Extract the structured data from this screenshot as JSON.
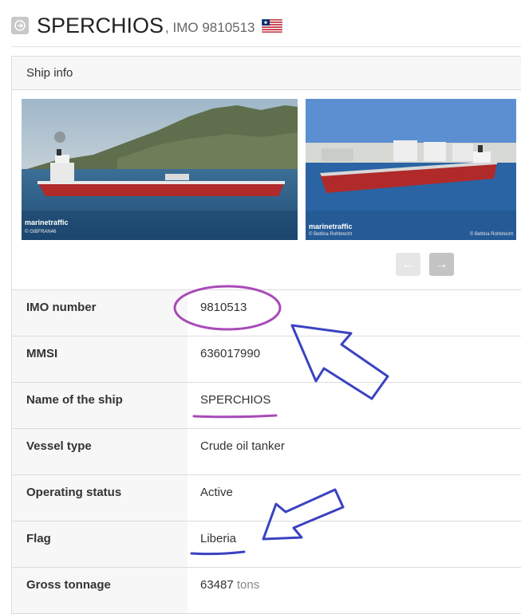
{
  "header": {
    "ship_name": "SPERCHIOS",
    "subtitle": ", IMO 9810513",
    "flag_icon": "liberia-flag-icon"
  },
  "panel": {
    "title": "Ship info"
  },
  "gallery": {
    "photos": [
      {
        "watermark": "marinetraffic",
        "credit": "© GIBFRAN46",
        "credit_right": ""
      },
      {
        "watermark": "marinetraffic",
        "credit": "© Bettina Rohbrecht",
        "credit_right": "© Bettina Rohbrecht"
      }
    ],
    "prev_label": "←",
    "next_label": "→"
  },
  "rows": [
    {
      "label": "IMO number",
      "value": "9810513",
      "unit": ""
    },
    {
      "label": "MMSI",
      "value": "636017990",
      "unit": ""
    },
    {
      "label": "Name of the ship",
      "value": "SPERCHIOS",
      "unit": ""
    },
    {
      "label": "Vessel type",
      "value": "Crude oil tanker",
      "unit": ""
    },
    {
      "label": "Operating status",
      "value": "Active",
      "unit": ""
    },
    {
      "label": "Flag",
      "value": "Liberia",
      "unit": ""
    },
    {
      "label": "Gross tonnage",
      "value": "63487",
      "unit": "tons"
    }
  ],
  "colors": {
    "annotation_purple": "#a84bb8",
    "annotation_blue": "#3b43c0",
    "hull_red": "#b02a2a"
  }
}
